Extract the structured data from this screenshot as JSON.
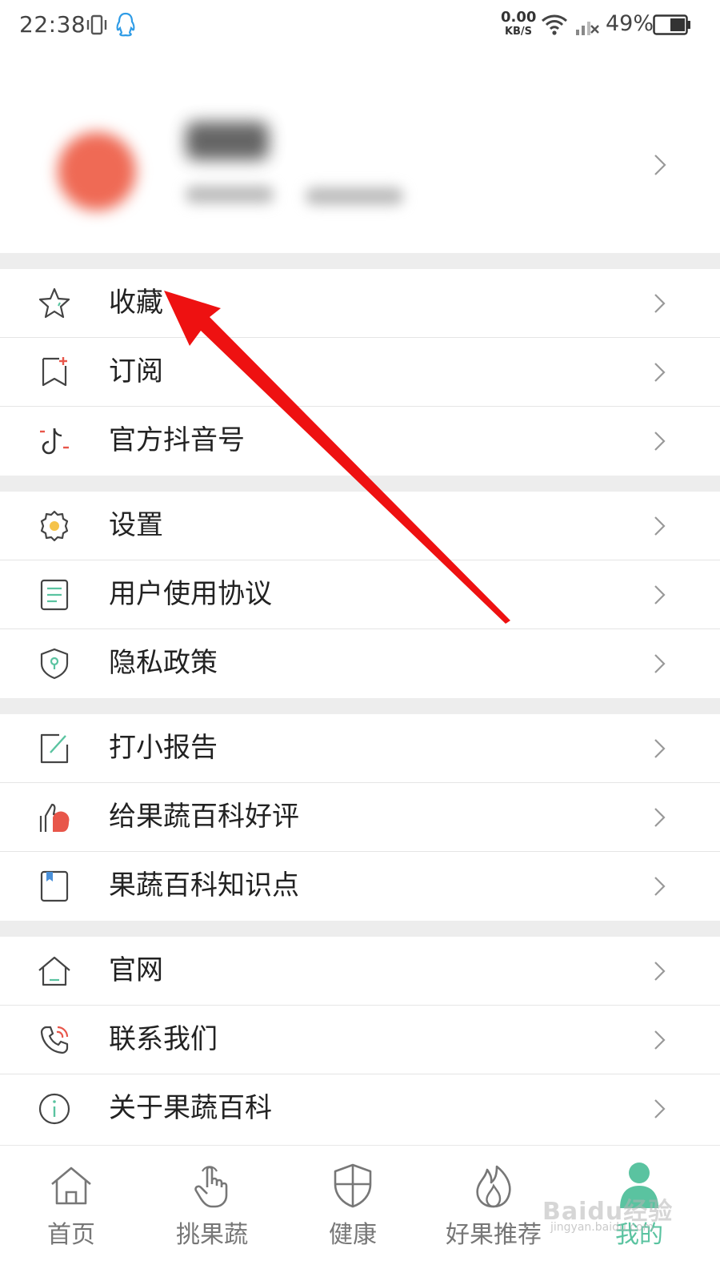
{
  "status_bar": {
    "time": "22:38",
    "net_speed_value": "0.00",
    "net_speed_unit": "KB/S",
    "battery_percent": "49%"
  },
  "colors": {
    "accent": "#5ac3a0",
    "arrow": "#ee1111",
    "avatar": "#ef6a55",
    "separator": "#ededed"
  },
  "menu": {
    "group1": [
      {
        "label": "收藏",
        "icon": "star-icon"
      },
      {
        "label": "订阅",
        "icon": "bookmark-plus-icon"
      },
      {
        "label": "官方抖音号",
        "icon": "tiktok-icon"
      }
    ],
    "group2": [
      {
        "label": "设置",
        "icon": "gear-icon"
      },
      {
        "label": "用户使用协议",
        "icon": "document-icon"
      },
      {
        "label": "隐私政策",
        "icon": "shield-icon"
      }
    ],
    "group3": [
      {
        "label": "打小报告",
        "icon": "edit-icon"
      },
      {
        "label": "给果蔬百科好评",
        "icon": "thumbs-up-icon"
      },
      {
        "label": "果蔬百科知识点",
        "icon": "bookmark-icon"
      }
    ],
    "group4": [
      {
        "label": "官网",
        "icon": "home-icon"
      },
      {
        "label": "联系我们",
        "icon": "phone-icon"
      },
      {
        "label": "关于果蔬百科",
        "icon": "info-icon"
      }
    ]
  },
  "bottom_nav": [
    {
      "label": "首页",
      "icon": "home-icon"
    },
    {
      "label": "挑果蔬",
      "icon": "hand-pointer-icon"
    },
    {
      "label": "健康",
      "icon": "shield-cross-icon"
    },
    {
      "label": "好果推荐",
      "icon": "flame-icon"
    },
    {
      "label": "我的",
      "icon": "user-icon",
      "active": true
    }
  ],
  "watermark": {
    "brand": "Baidu经验",
    "url": "jingyan.baidu.com"
  }
}
